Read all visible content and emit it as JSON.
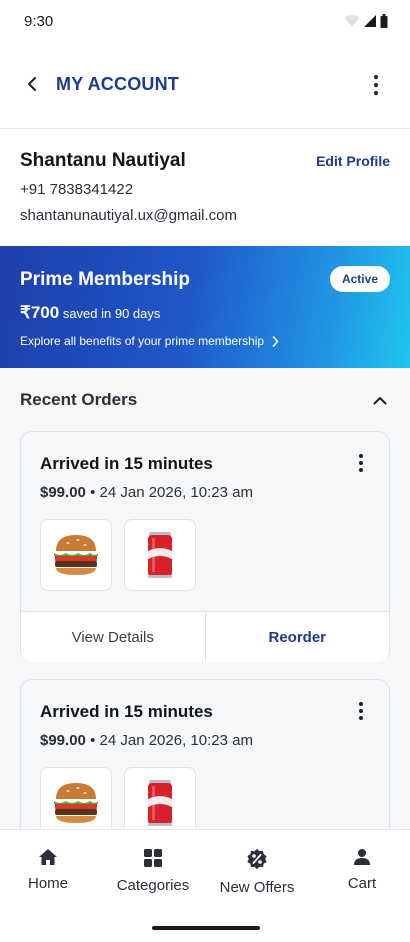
{
  "status_bar": {
    "time": "9:30"
  },
  "header": {
    "title": "MY ACCOUNT"
  },
  "profile": {
    "name": "Shantanu Nautiyal",
    "phone": "+91 7838341422",
    "email": "shantanunautiyal.ux@gmail.com",
    "edit_label": "Edit Profile"
  },
  "prime": {
    "title": "Prime Membership",
    "badge": "Active",
    "amount": "₹700",
    "saved_text": "saved in 90 days",
    "explore": "Explore all benefits of your prime membership"
  },
  "recent_orders": {
    "title": "Recent Orders",
    "orders": [
      {
        "title": "Arrived in 15 minutes",
        "price": "$99.00",
        "separator": "•",
        "datetime": "24 Jan 2026, 10:23 am",
        "items": [
          "burger",
          "cola-can"
        ],
        "view_label": "View Details",
        "reorder_label": "Reorder"
      },
      {
        "title": "Arrived in 15 minutes",
        "price": "$99.00",
        "separator": "•",
        "datetime": "24 Jan 2026, 10:23 am",
        "items": [
          "burger",
          "cola-can"
        ]
      }
    ]
  },
  "bottom_nav": [
    {
      "label": "Home",
      "icon": "home-icon"
    },
    {
      "label": "Categories",
      "icon": "categories-icon"
    },
    {
      "label": "New Offers",
      "icon": "offers-icon"
    },
    {
      "label": "Cart",
      "icon": "cart-icon"
    }
  ],
  "colors": {
    "accent": "#1f3a8f",
    "prime_start": "#1e3fa8",
    "prime_end": "#1fc6f0"
  }
}
